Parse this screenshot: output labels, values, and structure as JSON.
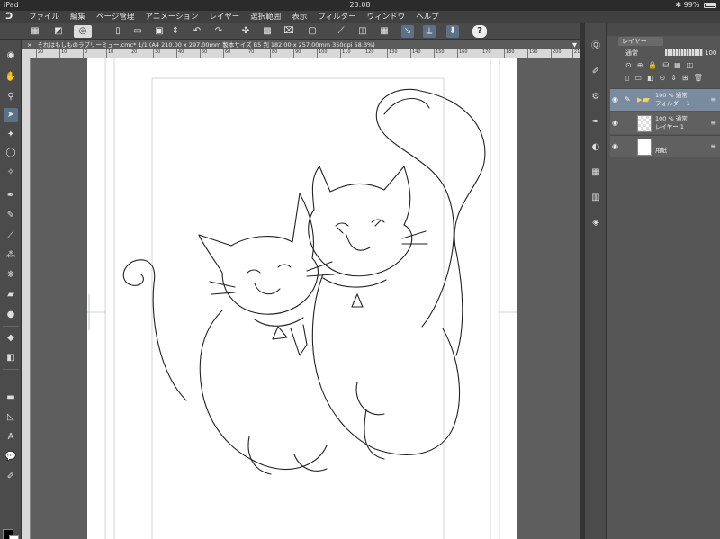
{
  "status": {
    "device": "iPad",
    "time": "23:08",
    "bluetooth": "✱",
    "battery": "99%"
  },
  "menu": [
    "ファイル",
    "編集",
    "ページ管理",
    "アニメーション",
    "レイヤー",
    "選択範囲",
    "表示",
    "フィルター",
    "ウィンドウ",
    "ヘルプ"
  ],
  "document": {
    "close": "×",
    "title": "それはもしものラブリーミュー.cmc* 1/1 (A4 210.00 x 297.00mm 製本サイズ B5 判 182.00 x 257.00mm 350dpi 58.3%)",
    "more": "▼"
  },
  "ruler": {
    "ticks": [
      "20",
      "10",
      "0",
      "10",
      "20",
      "30",
      "40",
      "50",
      "60",
      "70",
      "80",
      "90",
      "100",
      "110",
      "120",
      "130",
      "140",
      "150",
      "160",
      "170",
      "180",
      "190",
      "200",
      "210"
    ]
  },
  "layers_panel": {
    "tab_label": "レイヤー",
    "blend_mode": "通常",
    "opacity": "100",
    "layers": [
      {
        "line1": "100 % 通常",
        "line2": "フォルダー 1",
        "type": "folder",
        "selected": true
      },
      {
        "line1": "100 % 通常",
        "line2": "レイヤー 1",
        "type": "raster",
        "selected": false
      },
      {
        "line1": "",
        "line2": "用紙",
        "type": "paper",
        "selected": false
      }
    ]
  },
  "colors": {
    "accent": "#5d7186",
    "layer_selected": "#7a8ba0",
    "main_color": "#000000",
    "sub_color": "#ffffff"
  }
}
